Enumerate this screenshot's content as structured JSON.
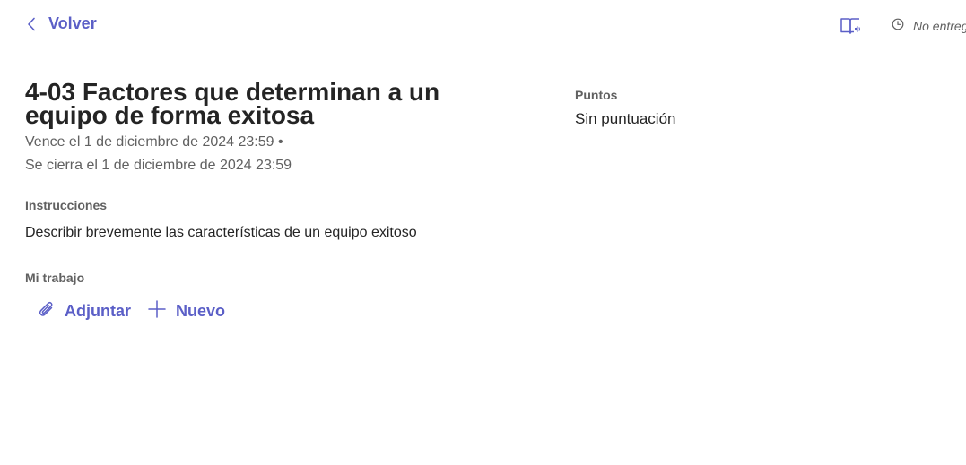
{
  "header": {
    "back_label": "Volver",
    "status_text": "No entreg"
  },
  "assignment": {
    "title": "4-03 Factores que determinan a un equipo de forma exitosa",
    "due": "Vence el 1 de diciembre de 2024 23:59 •",
    "closes": "Se cierra el 1 de diciembre de 2024 23:59"
  },
  "instructions": {
    "label": "Instrucciones",
    "text": "Describir brevemente las características de un equipo exitoso"
  },
  "my_work": {
    "label": "Mi trabajo",
    "attach_label": "Adjuntar",
    "new_label": "Nuevo"
  },
  "points": {
    "label": "Puntos",
    "value": "Sin puntuación"
  },
  "colors": {
    "accent": "#5b5fc7",
    "secondary_text": "#616161",
    "primary_text": "#242424"
  },
  "icons": {
    "back": "chevron-left-icon",
    "reader": "immersive-reader-icon",
    "status": "clock-icon",
    "attach": "paperclip-icon",
    "new": "plus-icon"
  }
}
